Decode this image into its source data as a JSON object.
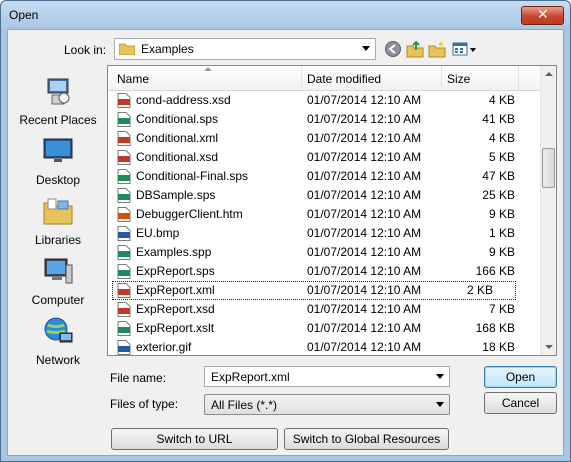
{
  "window": {
    "title": "Open",
    "close_glyph": "✕"
  },
  "toolbar": {
    "look_in_label": "Look in:",
    "look_in_value": "Examples",
    "icons": [
      "back-icon",
      "up-folder-icon",
      "new-folder-icon",
      "view-menu-icon"
    ]
  },
  "places": [
    {
      "label": "Recent Places",
      "icon": "recent-places-icon"
    },
    {
      "label": "Desktop",
      "icon": "desktop-icon"
    },
    {
      "label": "Libraries",
      "icon": "libraries-icon"
    },
    {
      "label": "Computer",
      "icon": "computer-icon"
    },
    {
      "label": "Network",
      "icon": "network-icon"
    }
  ],
  "list": {
    "columns": {
      "name": "Name",
      "date": "Date modified",
      "size": "Size"
    },
    "rows": [
      {
        "name": "cond-address.xsd",
        "date": "01/07/2014 12:10 AM",
        "size": "4 KB",
        "icon": "xsd-file-icon",
        "color": "#c0392b"
      },
      {
        "name": "Conditional.sps",
        "date": "01/07/2014 12:10 AM",
        "size": "41 KB",
        "icon": "sps-file-icon",
        "color": "#1e8c5a"
      },
      {
        "name": "Conditional.xml",
        "date": "01/07/2014 12:10 AM",
        "size": "4 KB",
        "icon": "xml-file-icon",
        "color": "#c0392b"
      },
      {
        "name": "Conditional.xsd",
        "date": "01/07/2014 12:10 AM",
        "size": "5 KB",
        "icon": "xsd-file-icon",
        "color": "#c0392b"
      },
      {
        "name": "Conditional-Final.sps",
        "date": "01/07/2014 12:10 AM",
        "size": "47 KB",
        "icon": "sps-file-icon",
        "color": "#1e8c5a"
      },
      {
        "name": "DBSample.sps",
        "date": "01/07/2014 12:10 AM",
        "size": "25 KB",
        "icon": "sps-file-icon",
        "color": "#1e8c5a"
      },
      {
        "name": "DebuggerClient.htm",
        "date": "01/07/2014 12:10 AM",
        "size": "9 KB",
        "icon": "htm-file-icon",
        "color": "#d35400"
      },
      {
        "name": "EU.bmp",
        "date": "01/07/2014 12:10 AM",
        "size": "1 KB",
        "icon": "bmp-file-icon",
        "color": "#2c5aa0"
      },
      {
        "name": "Examples.spp",
        "date": "01/07/2014 12:10 AM",
        "size": "9 KB",
        "icon": "spp-file-icon",
        "color": "#1e8c5a"
      },
      {
        "name": "ExpReport.sps",
        "date": "01/07/2014 12:10 AM",
        "size": "166 KB",
        "icon": "sps-file-icon",
        "color": "#1e8c5a"
      },
      {
        "name": "ExpReport.xml",
        "date": "01/07/2014 12:10 AM",
        "size": "2 KB",
        "icon": "xml-file-icon",
        "color": "#c0392b",
        "selected": true
      },
      {
        "name": "ExpReport.xsd",
        "date": "01/07/2014 12:10 AM",
        "size": "7 KB",
        "icon": "xsd-file-icon",
        "color": "#c0392b"
      },
      {
        "name": "ExpReport.xslt",
        "date": "01/07/2014 12:10 AM",
        "size": "168 KB",
        "icon": "xslt-file-icon",
        "color": "#1e8c5a"
      },
      {
        "name": "exterior.gif",
        "date": "01/07/2014 12:10 AM",
        "size": "18 KB",
        "icon": "gif-file-icon",
        "color": "#2c5aa0"
      }
    ]
  },
  "form": {
    "file_name_label": "File name:",
    "file_name_value": "ExpReport.xml",
    "file_type_label": "Files of type:",
    "file_type_value": "All Files (*.*)"
  },
  "buttons": {
    "open": "Open",
    "cancel": "Cancel",
    "switch_url": "Switch to URL",
    "switch_global": "Switch to Global Resources"
  }
}
